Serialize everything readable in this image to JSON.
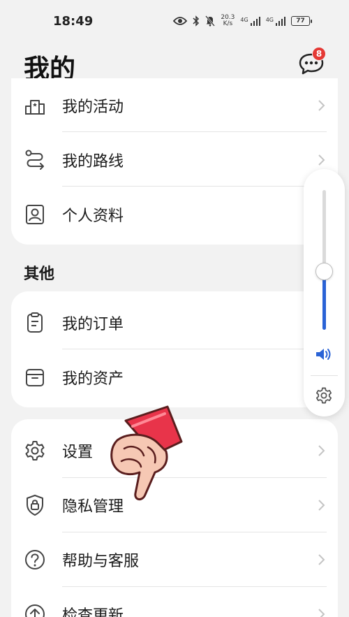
{
  "status_bar": {
    "time": "18:49",
    "net_speed_value": "20.3",
    "net_speed_unit": "K/s",
    "signal1_label": "4G",
    "signal2_label": "4G",
    "battery": "77"
  },
  "header": {
    "title": "我的",
    "message_badge": "8"
  },
  "card1": {
    "items": [
      {
        "label": "我的活动",
        "icon": "podium-icon"
      },
      {
        "label": "我的路线",
        "icon": "route-icon"
      },
      {
        "label": "个人资料",
        "icon": "profile-icon"
      }
    ]
  },
  "section_other": {
    "title": "其他",
    "items": [
      {
        "label": "我的订单",
        "icon": "clipboard-icon"
      },
      {
        "label": "我的资产",
        "icon": "box-icon"
      }
    ]
  },
  "card3": {
    "items": [
      {
        "label": "设置",
        "icon": "gear-icon"
      },
      {
        "label": "隐私管理",
        "icon": "shield-lock-icon"
      },
      {
        "label": "帮助与客服",
        "icon": "help-icon"
      },
      {
        "label": "检查更新",
        "icon": "upload-icon"
      }
    ]
  },
  "volume": {
    "level": 0.42,
    "accent": "#2a63d6"
  },
  "colors": {
    "background": "#f2f2f2",
    "card": "#ffffff",
    "badge": "#e53935"
  }
}
